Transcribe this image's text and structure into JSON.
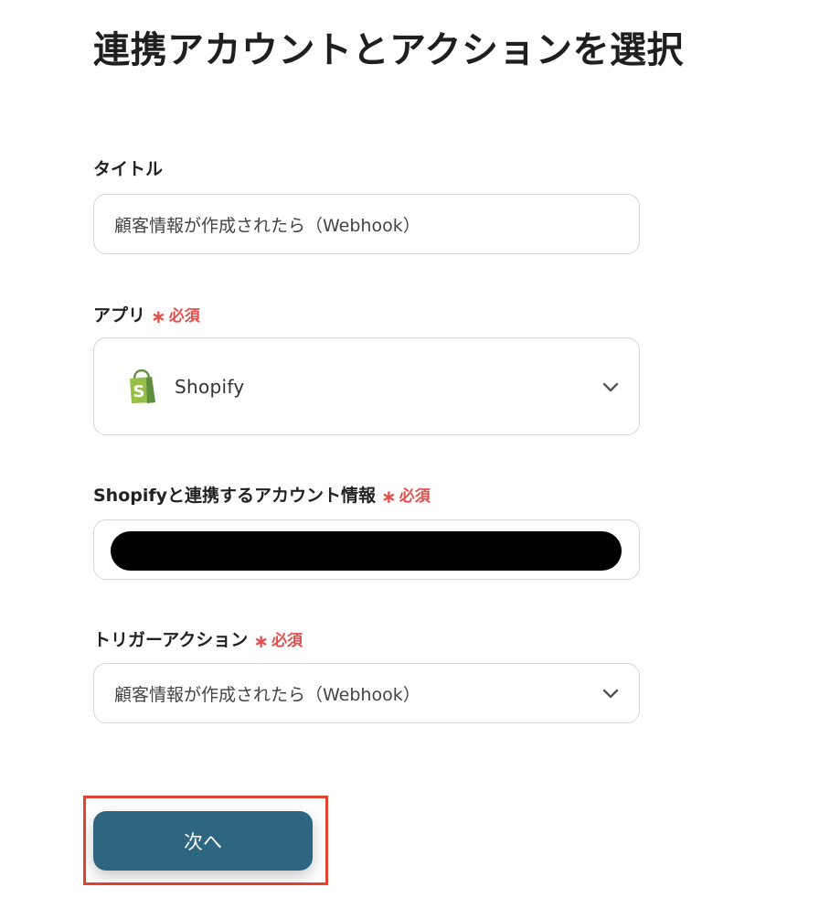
{
  "page": {
    "title": "連携アカウントとアクションを選択"
  },
  "form": {
    "title_field": {
      "label": "タイトル",
      "value": "顧客情報が作成されたら（Webhook）"
    },
    "app_field": {
      "label": "アプリ",
      "required_text": "必須",
      "selected_app": "Shopify",
      "app_icon": "shopify-bag-icon"
    },
    "account_field": {
      "label": "Shopifyと連携するアカウント情報",
      "required_text": "必須"
    },
    "trigger_field": {
      "label": "トリガーアクション",
      "required_text": "必須",
      "selected_value": "顧客情報が作成されたら（Webhook）"
    }
  },
  "actions": {
    "next_label": "次へ"
  },
  "colors": {
    "required": "#e0504f",
    "button_bg": "#2e6682",
    "highlight": "#e2442f",
    "shopify_green": "#95bf47"
  }
}
